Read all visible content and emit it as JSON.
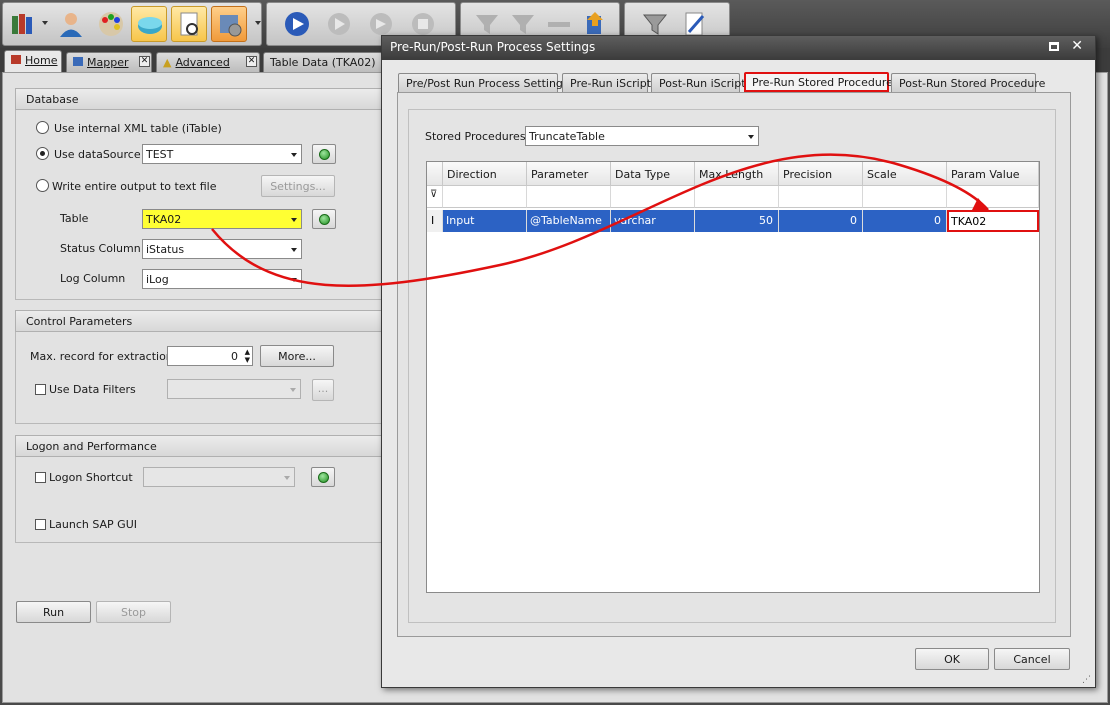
{
  "toolbar": {
    "groups": [
      {
        "icons": [
          "books-icon",
          "user-icon",
          "color-palette-icon",
          "database-disk-icon",
          "document-search-icon",
          "database-settings-icon"
        ]
      },
      {
        "icons": [
          "play-icon",
          "step-icon",
          "step-over-icon",
          "stop-icon"
        ]
      },
      {
        "icons": [
          "funnel-settings-icon",
          "funnel-run-icon",
          "link-icon",
          "export-icon"
        ]
      },
      {
        "icons": [
          "filter-icon",
          "edit-document-icon"
        ]
      }
    ]
  },
  "doc_tabs": [
    {
      "label": "Home"
    },
    {
      "label": "Mapper"
    },
    {
      "label": "Advanced"
    },
    {
      "label": "Table Data (TKA02)"
    }
  ],
  "database": {
    "header": "Database",
    "opt_xml": "Use internal XML table (iTable)",
    "opt_datasource": "Use dataSource",
    "datasource_value": "TEST",
    "opt_textfile": "Write entire output to text file",
    "settings_btn": "Settings...",
    "table_label": "Table",
    "table_value": "TKA02",
    "status_label": "Status Column",
    "status_value": "iStatus",
    "log_label": "Log Column",
    "log_value": "iLog"
  },
  "control": {
    "header": "Control Parameters",
    "max_label": "Max. record for extraction",
    "max_value": "0",
    "more_btn": "More...",
    "filters_label": "Use Data Filters",
    "ellipsis_btn": "..."
  },
  "logon": {
    "header": "Logon and Performance",
    "shortcut_label": "Logon Shortcut",
    "sapgui_label": "Launch SAP GUI"
  },
  "actions": {
    "run": "Run",
    "stop": "Stop"
  },
  "dialog": {
    "title": "Pre-Run/Post-Run Process Settings",
    "tabs": [
      {
        "label": "Pre/Post Run Process Settings"
      },
      {
        "label": "Pre-Run iScript"
      },
      {
        "label": "Post-Run iScript"
      },
      {
        "label": "Pre-Run Stored Procedure"
      },
      {
        "label": "Post-Run Stored Procedure"
      }
    ],
    "active_tab": "Pre-Run Stored Procedure",
    "sp_label": "Stored Procedures",
    "sp_value": "TruncateTable",
    "grid": {
      "columns": [
        "Direction",
        "Parameter",
        "Data Type",
        "Max Length",
        "Precision",
        "Scale",
        "Param Value"
      ],
      "rows": [
        {
          "direction": "Input",
          "parameter": "@TableName",
          "data_type": "varchar",
          "max_length": "50",
          "precision": "0",
          "scale": "0",
          "param_value": "TKA02"
        }
      ]
    },
    "ok": "OK",
    "cancel": "Cancel"
  },
  "colors": {
    "highlight_red": "#e01010",
    "selection_blue": "#2c62c4",
    "table_field_yellow": "#ffff33"
  }
}
